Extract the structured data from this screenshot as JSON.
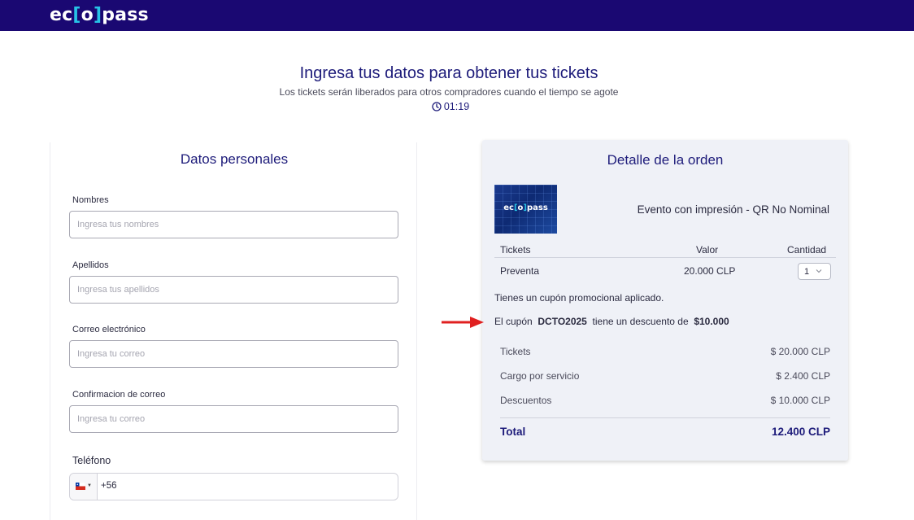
{
  "brand": {
    "logo_pre": "ec",
    "logo_bracket_open": "[",
    "logo_o": "o",
    "logo_bracket_close": "]",
    "logo_post": "pass",
    "color": "#1a0872",
    "accent": "#27c3e6"
  },
  "hero": {
    "title": "Ingresa tus datos para obtener tus tickets",
    "subtitle": "Los tickets serán liberados para otros compradores cuando el tiempo se agote",
    "timer": "01:19",
    "timer_icon": "clock-icon"
  },
  "personal": {
    "title": "Datos personales",
    "fields": [
      {
        "label": "Nombres",
        "placeholder": "Ingresa tus nombres"
      },
      {
        "label": "Apellidos",
        "placeholder": "Ingresa tus apellidos"
      },
      {
        "label": "Correo electrónico",
        "placeholder": "Ingresa tu correo"
      },
      {
        "label": "Confirmacion de correo",
        "placeholder": "Ingresa tu correo"
      }
    ],
    "phone": {
      "label": "Teléfono",
      "country_icon": "chile-flag-icon",
      "prefix": "+56"
    }
  },
  "order": {
    "title": "Detalle de la orden",
    "event_name": "Evento con impresión - QR No Nominal",
    "table": {
      "headers": {
        "tickets": "Tickets",
        "value": "Valor",
        "quantity": "Cantidad"
      },
      "row": {
        "name": "Preventa",
        "price": "20.000 CLP",
        "quantity": "1"
      }
    },
    "promo_text": "Tienes un cupón promocional aplicado.",
    "coupon": {
      "prefix": "El cupón",
      "code": "DCTO2025",
      "middle": "tiene un descuento de",
      "amount": "$10.000"
    },
    "summary": [
      {
        "label": "Tickets",
        "value": "$ 20.000 CLP"
      },
      {
        "label": "Cargo por servicio",
        "value": "$ 2.400 CLP"
      },
      {
        "label": "Descuentos",
        "value": "$ 10.000 CLP"
      }
    ],
    "total": {
      "label": "Total",
      "value": "12.400 CLP"
    }
  },
  "annotation": {
    "arrow_icon": "red-arrow-icon",
    "arrow_color": "#e02020"
  }
}
